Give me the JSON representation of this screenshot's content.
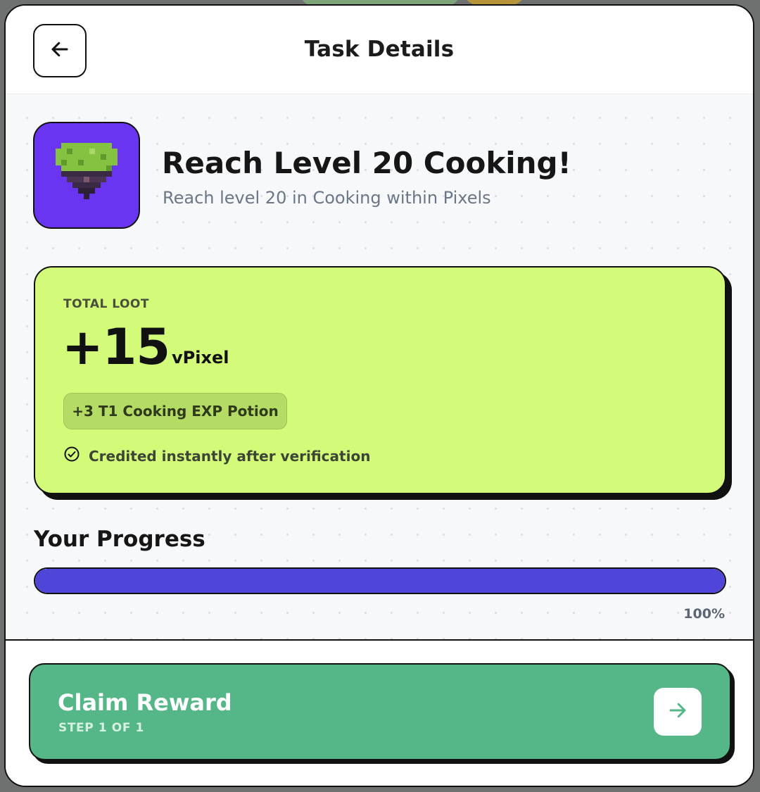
{
  "header": {
    "title": "Task Details",
    "back_icon": "arrow-left-icon"
  },
  "task": {
    "icon": "pixel-tree-icon",
    "title": "Reach Level 20 Cooking!",
    "subtitle": "Reach level 20 in Cooking within Pixels"
  },
  "loot": {
    "label": "TOTAL LOOT",
    "amount": "+15",
    "unit": "vPixel",
    "bonus": "+3 T1 Cooking EXP Potion",
    "note": "Credited instantly after verification",
    "note_icon": "check-circle-icon",
    "accent": "#d3fa78"
  },
  "progress": {
    "title": "Your Progress",
    "percent_label": "100%",
    "value": 1.0,
    "fill_color": "#4f46d9"
  },
  "claim": {
    "label": "Claim Reward",
    "step": "STEP 1 OF 1",
    "arrow_icon": "arrow-right-icon",
    "color": "#55b687"
  }
}
